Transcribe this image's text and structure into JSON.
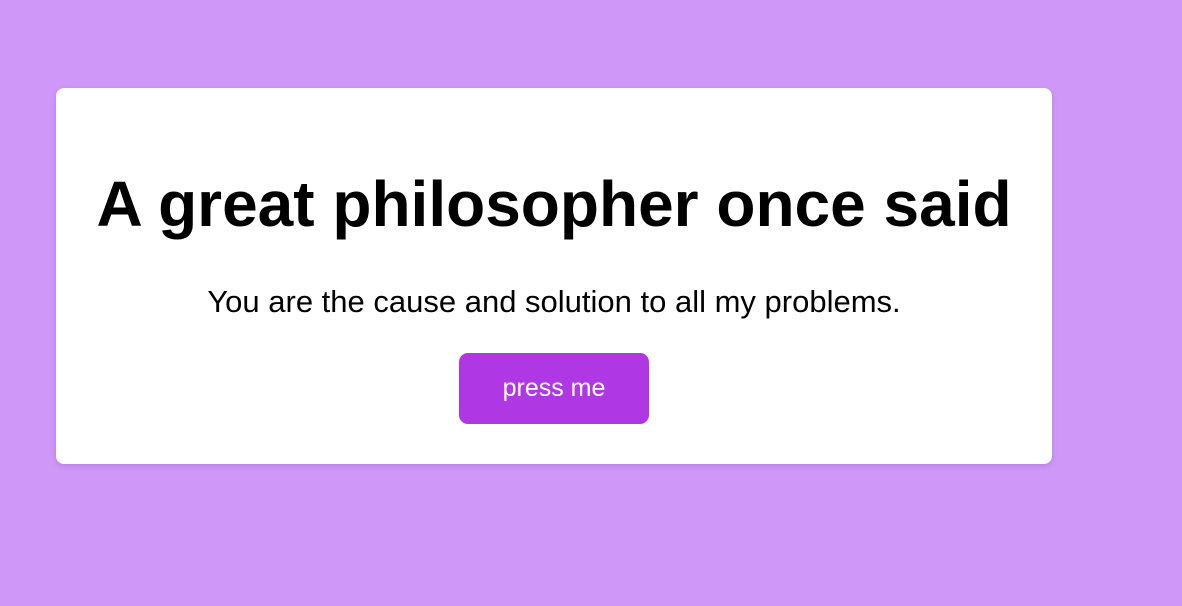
{
  "card": {
    "title": "A great philosopher once said",
    "quote": "You are the cause and solution to all my problems.",
    "button_label": "press me"
  },
  "colors": {
    "page_background": "#cf98f8",
    "card_background": "#ffffff",
    "button_background": "#b038e4",
    "button_text": "#ffffff"
  }
}
